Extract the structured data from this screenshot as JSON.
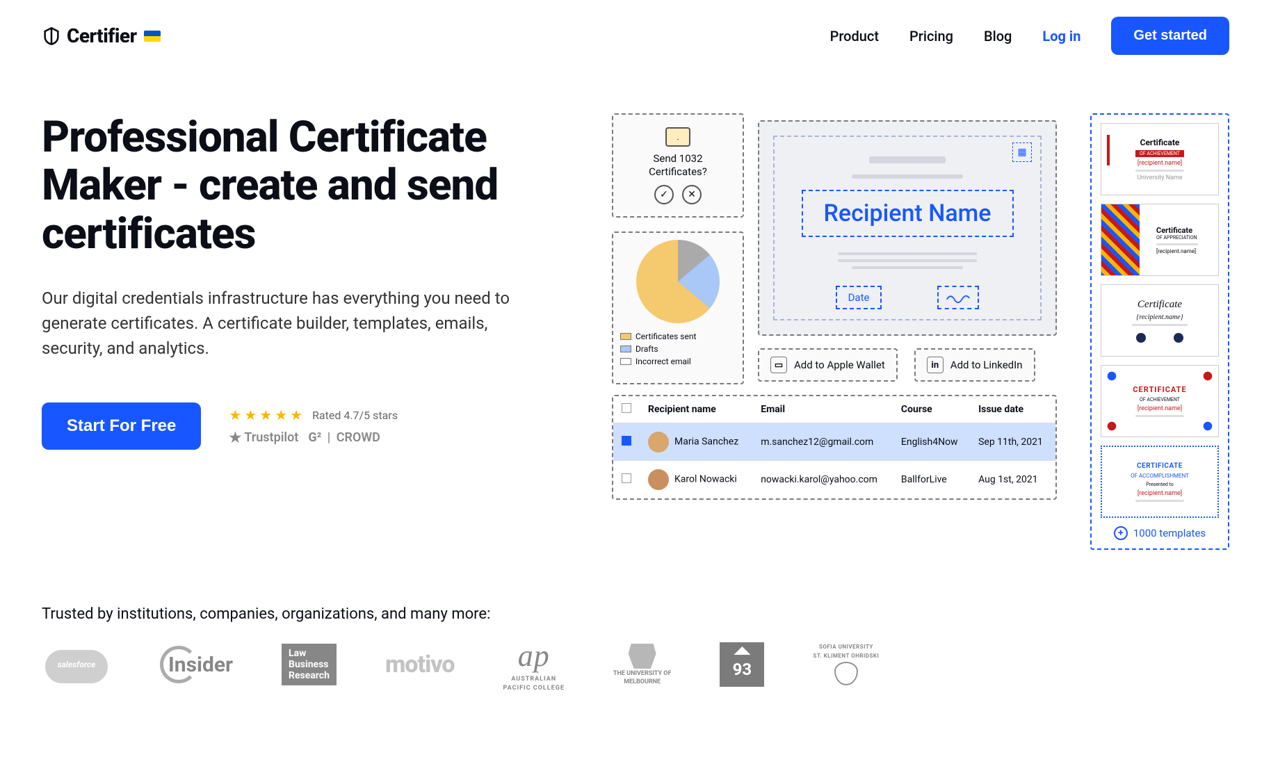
{
  "brand": "Certifier",
  "nav": {
    "product": "Product",
    "pricing": "Pricing",
    "blog": "Blog",
    "login": "Log in",
    "cta": "Get started"
  },
  "hero": {
    "title": "Professional Certificate Maker - create and send certificates",
    "subtitle": "Our digital credentials infrastructure has everything you need to generate certificates. A certificate builder, templates, emails, security, and analytics.",
    "cta": "Start For Free",
    "rating_text": "Rated 4.7/5 stars",
    "trustpilot": "Trustpilot",
    "g2": "G²",
    "crowd": "CROWD"
  },
  "diagram": {
    "send": {
      "line1": "Send 1032",
      "line2": "Certificates?"
    },
    "analytics": {
      "legend": {
        "sent": "Certificates sent",
        "drafts": "Drafts",
        "err": "Incorrect email"
      }
    },
    "preview": {
      "recipient": "Recipient Name",
      "date": "Date"
    },
    "integrations": {
      "wallet": "Add to Apple Wallet",
      "linkedin": "Add to LinkedIn",
      "linkedin_icon": "in"
    },
    "table": {
      "headers": {
        "name": "Recipient name",
        "email": "Email",
        "course": "Course",
        "issue": "Issue date"
      },
      "rows": [
        {
          "name": "Maria Sanchez",
          "email": "m.sanchez12@gmail.com",
          "course": "English4Now",
          "issue": "Sep 11th, 2021"
        },
        {
          "name": "Karol Nowacki",
          "email": "nowacki.karol@yahoo.com",
          "course": "BallforLive",
          "issue": "Aug 1st, 2021"
        }
      ]
    }
  },
  "templates": {
    "t1": {
      "title": "Certificate",
      "rec": "[recipient.name]",
      "uni": "University Name"
    },
    "t2": {
      "title": "Certificate",
      "sub": "OF APPRECIATION",
      "rec": "[recipient.name]"
    },
    "t3": {
      "title": "Certificate",
      "rec": "{recipient.name}"
    },
    "t4": {
      "title": "CERTIFICATE",
      "rec": "[recipient.name]"
    },
    "t5": {
      "title": "CERTIFICATE",
      "sub": "OF ACCOMPLISHMENT",
      "presented": "Presented to",
      "rec": "[recipient.name]"
    },
    "more": "1000 templates"
  },
  "trusted": {
    "heading": "Trusted by institutions, companies, organizations, and many more:",
    "logos": {
      "lbr_l1": "Law",
      "lbr_l2": "Business",
      "lbr_l3": "Research",
      "motivo": "motivo",
      "apc_l1": "AUSTRALIAN",
      "apc_l2": "PACIFIC COLLEGE",
      "mel_l1": "THE UNIVERSITY OF",
      "mel_l2": "MELBOURNE",
      "g93": "93",
      "sofia_l1": "SOFIA UNIVERSITY",
      "sofia_l2": "ST. KLIMENT OHRIDSKI",
      "insider": "Insider"
    }
  }
}
